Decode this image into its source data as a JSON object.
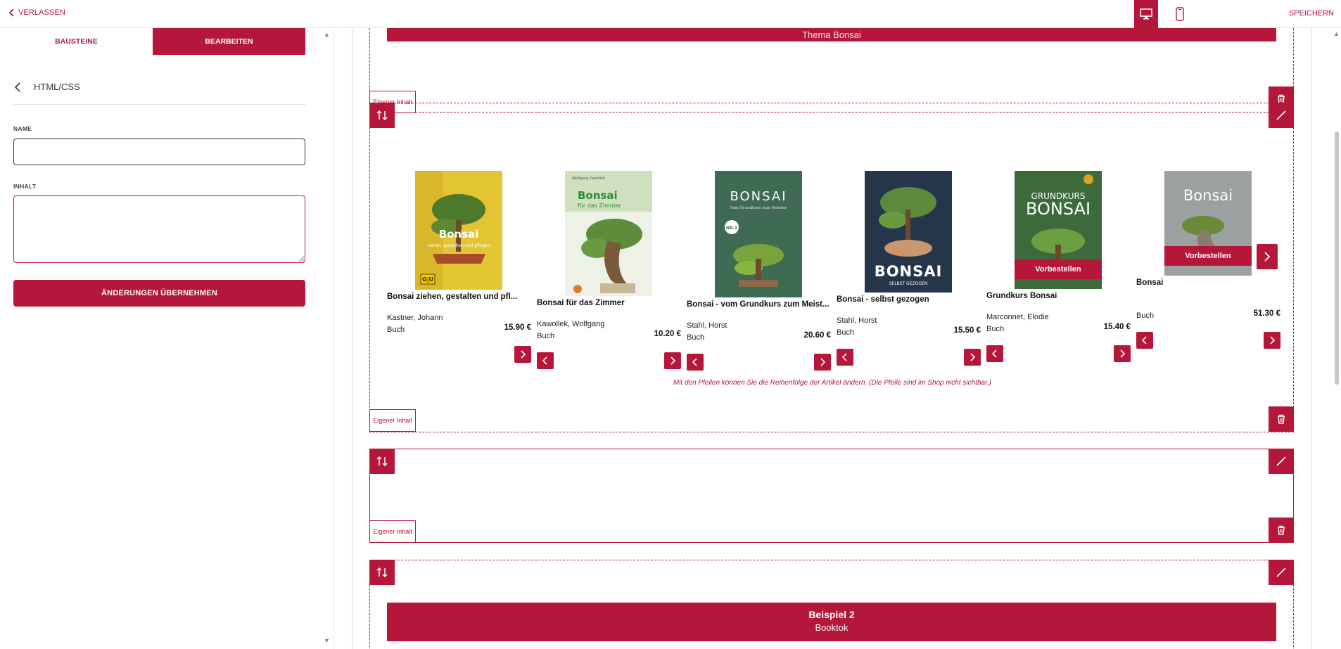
{
  "topbar": {
    "leave_label": "VERLASSEN",
    "save_label": "SPEICHERN"
  },
  "leftpanel": {
    "tabs": [
      {
        "label": "BAUSTEINE"
      },
      {
        "label": "BEARBEITEN"
      }
    ],
    "breadcrumb": "HTML/CSS",
    "name_label": "NAME",
    "name_value": "",
    "content_label": "INHALT",
    "content_value": "",
    "apply_label": "ÄNDERUNGEN ÜBERNEHMEN"
  },
  "canvas": {
    "top_banner_text": "Thema Bonsai",
    "own_content_label": "Eigener Inhalt",
    "hint": "Mit den Pfeilen können Sie die Reihenfolge der Artikel ändern. (Die Pfeile sind im Shop nicht sichtbar.)",
    "example_title": "Beispiel 2",
    "example_subtitle": "Booktok",
    "products": [
      {
        "title": "Bonsai ziehen, gestalten und pfl...",
        "author": "Kastner, Johann",
        "type": "Buch",
        "price": "15.90 €",
        "cover_text": "Bonsai",
        "cover_sub": "ziehen, gestalten und pflegen",
        "badge": "",
        "cover_color": "#e3c534"
      },
      {
        "title": "Bonsai für das Zimmer",
        "author": "Kawollek, Wolfgang",
        "type": "Buch",
        "price": "10.20 €",
        "cover_text": "Bonsai",
        "cover_sub": "für das Zimmer",
        "badge": "",
        "cover_color": "#d9e6c6"
      },
      {
        "title": "Bonsai - vom Grundkurs zum Meist...",
        "author": "Stahl, Horst",
        "type": "Buch",
        "price": "20.60 €",
        "cover_text": "BONSAI",
        "cover_sub": "Vom Grundkurs zum Meister",
        "badge": "",
        "cover_color": "#3f6b55"
      },
      {
        "title": "Bonsai - selbst gezogen",
        "author": "Stahl, Horst",
        "type": "Buch",
        "price": "15.50 €",
        "cover_text": "BONSAI",
        "cover_sub": "SELBST GEZOGEN",
        "badge": "",
        "cover_color": "#25364a"
      },
      {
        "title": "Grundkurs Bonsai",
        "author": "Marconnet, Elodie",
        "type": "Buch",
        "price": "15.40 €",
        "cover_text": "BONSAI",
        "cover_sub": "GRUNDKURS",
        "badge": "Vorbestellen",
        "cover_color": "#3d6a3a"
      },
      {
        "title": "Bonsai",
        "author": "",
        "type": "Buch",
        "price": "51.30 €",
        "cover_text": "Bonsai",
        "cover_sub": "",
        "badge": "Vorbestellen",
        "cover_color": "#9aa1a0"
      }
    ]
  },
  "colors": {
    "accent": "#b5173b"
  }
}
